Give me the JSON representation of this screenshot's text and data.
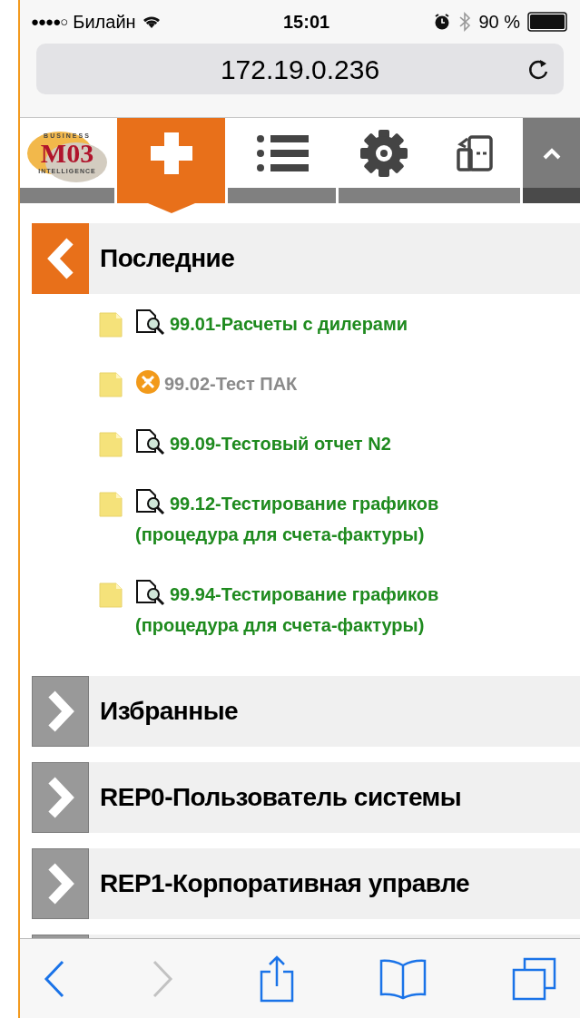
{
  "status_bar": {
    "signal": "●●●●○",
    "carrier": "Билайн",
    "time": "15:01",
    "battery": "90 %"
  },
  "address_bar": {
    "url": "172.19.0.236"
  },
  "toolbar": {
    "logo": {
      "top": "BUSINESS",
      "main": "M03",
      "bottom": "INTELLIGENCE"
    },
    "tabs": [
      {
        "kind": "logo",
        "selected": false
      },
      {
        "kind": "plus",
        "selected": true
      },
      {
        "kind": "list",
        "selected": false
      },
      {
        "kind": "gear",
        "selected": false
      },
      {
        "kind": "exit",
        "selected": false
      },
      {
        "kind": "collapse",
        "selected": false
      }
    ]
  },
  "sections": [
    {
      "title": "Последние",
      "expanded": true,
      "items": [
        {
          "kind": "report",
          "disabled": false,
          "label": "99.01-Расчеты с дилерами"
        },
        {
          "kind": "badge",
          "disabled": true,
          "label": "99.02-Тест ПАК"
        },
        {
          "kind": "report",
          "disabled": false,
          "label": "99.09-Тестовый отчет N2"
        },
        {
          "kind": "report",
          "disabled": false,
          "label": "99.12-Тестирование графиков (процедура для счета-фактуры)"
        },
        {
          "kind": "report",
          "disabled": false,
          "label": "99.94-Тестирование графиков (процедура для счета-фактуры)"
        }
      ]
    },
    {
      "title": "Избранные",
      "expanded": false
    },
    {
      "title": "REP0-Пользователь системы",
      "expanded": false
    },
    {
      "title": "REP1-Корпоративная управле",
      "expanded": false
    }
  ],
  "bottom_bar": {
    "back_enabled": true,
    "forward_enabled": false
  }
}
